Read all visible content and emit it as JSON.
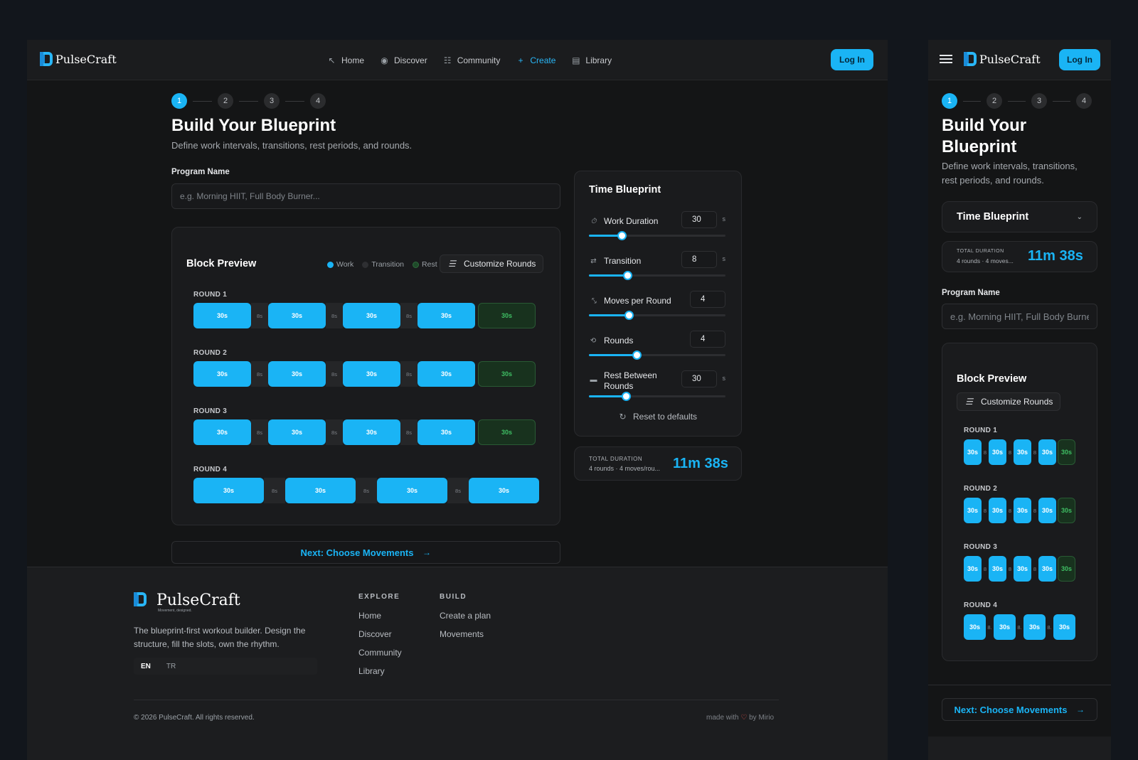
{
  "brand": {
    "name": "PulseCraft",
    "tagline": "Movement, designed."
  },
  "nav": {
    "links": [
      {
        "label": "Home",
        "icon": "trend-icon"
      },
      {
        "label": "Discover",
        "icon": "compass-icon"
      },
      {
        "label": "Community",
        "icon": "users-icon"
      },
      {
        "label": "Create",
        "icon": "plus-icon"
      },
      {
        "label": "Library",
        "icon": "book-icon"
      }
    ],
    "login_label": "Log In"
  },
  "steps": [
    "1",
    "2",
    "3",
    "4"
  ],
  "page": {
    "title": "Build Your Blueprint",
    "title_line1": "Build Your",
    "title_line2": "Blueprint",
    "subtitle": "Define work intervals, transitions, rest periods, and rounds.",
    "subtitle_line1": "Define work intervals, transitions,",
    "subtitle_line2": "rest periods, and rounds."
  },
  "program": {
    "label": "Program Name",
    "placeholder": "e.g. Morning HIIT, Full Body Burner..."
  },
  "preview": {
    "title": "Block Preview",
    "legend": {
      "work": "Work",
      "transition": "Transition",
      "rest": "Rest"
    },
    "customize_label": "Customize Rounds",
    "rounds": [
      {
        "label": "ROUND 1",
        "work": "30s",
        "transition": "8s",
        "rest": "30s"
      },
      {
        "label": "ROUND 2",
        "work": "30s",
        "transition": "8s",
        "rest": "30s"
      },
      {
        "label": "ROUND 3",
        "work": "30s",
        "transition": "8s",
        "rest": "30s"
      },
      {
        "label": "ROUND 4",
        "work": "30s",
        "transition": "8s"
      }
    ]
  },
  "blueprint": {
    "title": "Time Blueprint",
    "unit": "s",
    "fields": [
      {
        "label": "Work Duration",
        "value": "30",
        "level": 0.24,
        "icon": "timer-icon"
      },
      {
        "label": "Transition",
        "value": "8",
        "level": 0.28,
        "icon": "arrows-icon"
      },
      {
        "label": "Moves per Round",
        "value": "4",
        "level": 0.29,
        "icon": "expand-icon"
      },
      {
        "label": "Rounds",
        "value": "4",
        "level": 0.35,
        "icon": "repeat-icon"
      },
      {
        "label": "Rest Between Rounds",
        "label_line1": "Rest Between",
        "label_line2": "Rounds",
        "value": "30",
        "level": 0.27,
        "icon": "bed-icon"
      }
    ],
    "reset_label": "Reset to defaults"
  },
  "total": {
    "label": "TOTAL DURATION",
    "sub": "4 rounds · 4 moves/rou...",
    "sub_mobile": "4 rounds · 4 moves...",
    "value": "11m 38s"
  },
  "next_label": "Next: Choose Movements",
  "footer": {
    "description_line1": "The blueprint-first workout builder. Design the",
    "description_line2": "structure, fill the slots, own the rhythm.",
    "languages": {
      "en": "EN",
      "tr": "TR"
    },
    "explore": {
      "heading": "EXPLORE",
      "links": [
        "Home",
        "Discover",
        "Community",
        "Library"
      ]
    },
    "build": {
      "heading": "BUILD",
      "links": [
        "Create a plan",
        "Movements"
      ]
    },
    "copyright": "© 2026 PulseCraft. All rights reserved.",
    "made_with": "made with",
    "made_by": "by Mirio"
  },
  "colors": {
    "accent": "#1ab4f5",
    "rest": "#3fbf64",
    "background": "#141516"
  }
}
